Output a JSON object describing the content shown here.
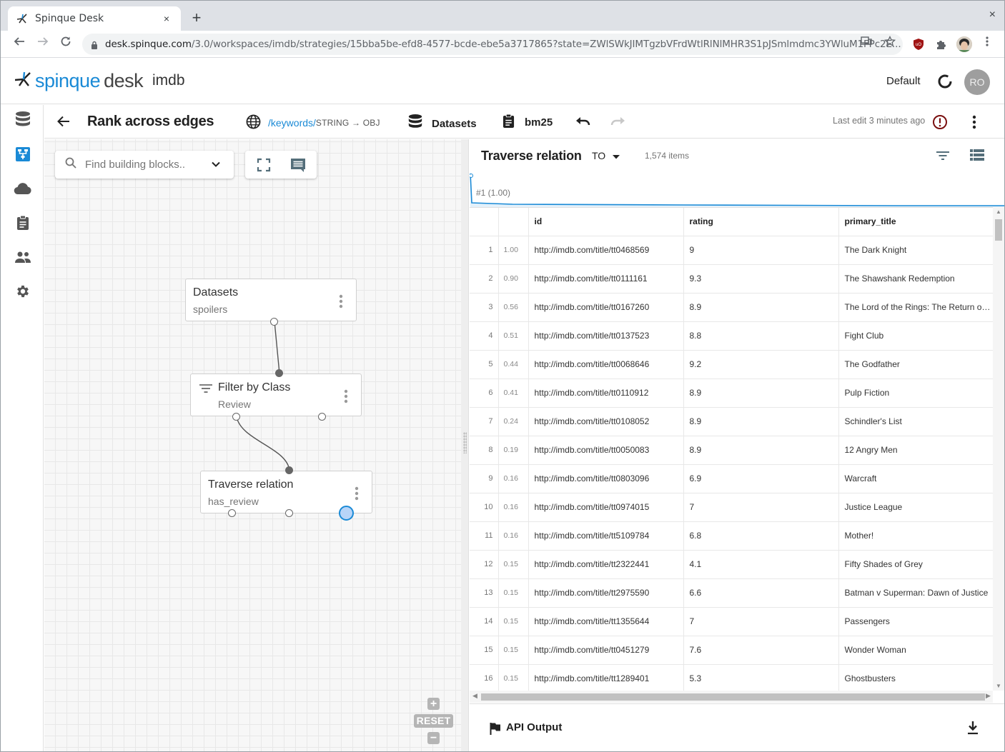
{
  "browser": {
    "tab_title": "Spinque Desk",
    "tab_close": "×",
    "new_tab": "+",
    "window_close": "×",
    "url_host": "desk.spinque.com",
    "url_path": "/3.0/workspaces/imdb/strategies/15bba5be-efd8-4577-bcde-ebe5a3717865?state=ZWlSWkJIMTgzbVFrdWtlRlNlMHR3S1pJSmlmdmc3YWluM1FPc2E..."
  },
  "app": {
    "brand_primary": "spinque",
    "brand_secondary": "desk",
    "workspace": "imdb",
    "environment": "Default",
    "avatar_initials": "RO",
    "accent_color": "#1a8ad6"
  },
  "sidebar": {
    "items": [
      {
        "name": "datasets",
        "icon": "database-icon",
        "active": false
      },
      {
        "name": "strategies",
        "icon": "strategy-icon",
        "active": true
      },
      {
        "name": "apis",
        "icon": "cloud-icon",
        "active": false
      },
      {
        "name": "descriptions",
        "icon": "clipboard-icon",
        "active": false
      },
      {
        "name": "members",
        "icon": "people-icon",
        "active": false
      },
      {
        "name": "settings",
        "icon": "gear-icon",
        "active": false
      }
    ]
  },
  "strategy_bar": {
    "title": "Rank across edges",
    "endpoint_prefix": "/",
    "endpoint_name": "keywords",
    "endpoint_sep": "/",
    "endpoint_types": "STRING → OBJ",
    "dataset_label": "Datasets",
    "description_label": "bm25",
    "last_edit": "Last edit 3 minutes ago"
  },
  "canvas": {
    "search_placeholder": "Find building blocks..",
    "zoom_in": "+",
    "zoom_reset": "RESET",
    "zoom_out": "−",
    "nodes": [
      {
        "title": "Datasets",
        "subtitle": "spoilers"
      },
      {
        "title": "Filter by Class",
        "subtitle": "Review"
      },
      {
        "title": "Traverse relation",
        "subtitle": "has_review"
      }
    ]
  },
  "results": {
    "title": "Traverse relation",
    "output_selector": "TO",
    "count": "1,574 items",
    "score_marker": "#1 (1.00)",
    "columns": [
      "",
      "",
      "id",
      "rating",
      "primary_title"
    ],
    "rows": [
      {
        "n": "1",
        "score": "1.00",
        "id": "http://imdb.com/title/tt0468569",
        "rating": "9",
        "title": "The Dark Knight"
      },
      {
        "n": "2",
        "score": "0.90",
        "id": "http://imdb.com/title/tt0111161",
        "rating": "9.3",
        "title": "The Shawshank Redemption"
      },
      {
        "n": "3",
        "score": "0.56",
        "id": "http://imdb.com/title/tt0167260",
        "rating": "8.9",
        "title": "The Lord of the Rings: The Return of the King"
      },
      {
        "n": "4",
        "score": "0.51",
        "id": "http://imdb.com/title/tt0137523",
        "rating": "8.8",
        "title": "Fight Club"
      },
      {
        "n": "5",
        "score": "0.44",
        "id": "http://imdb.com/title/tt0068646",
        "rating": "9.2",
        "title": "The Godfather"
      },
      {
        "n": "6",
        "score": "0.41",
        "id": "http://imdb.com/title/tt0110912",
        "rating": "8.9",
        "title": "Pulp Fiction"
      },
      {
        "n": "7",
        "score": "0.24",
        "id": "http://imdb.com/title/tt0108052",
        "rating": "8.9",
        "title": "Schindler's List"
      },
      {
        "n": "8",
        "score": "0.19",
        "id": "http://imdb.com/title/tt0050083",
        "rating": "8.9",
        "title": "12 Angry Men"
      },
      {
        "n": "9",
        "score": "0.16",
        "id": "http://imdb.com/title/tt0803096",
        "rating": "6.9",
        "title": "Warcraft"
      },
      {
        "n": "10",
        "score": "0.16",
        "id": "http://imdb.com/title/tt0974015",
        "rating": "7",
        "title": "Justice League"
      },
      {
        "n": "11",
        "score": "0.16",
        "id": "http://imdb.com/title/tt5109784",
        "rating": "6.8",
        "title": "Mother!"
      },
      {
        "n": "12",
        "score": "0.15",
        "id": "http://imdb.com/title/tt2322441",
        "rating": "4.1",
        "title": "Fifty Shades of Grey"
      },
      {
        "n": "13",
        "score": "0.15",
        "id": "http://imdb.com/title/tt2975590",
        "rating": "6.6",
        "title": "Batman v Superman: Dawn of Justice"
      },
      {
        "n": "14",
        "score": "0.15",
        "id": "http://imdb.com/title/tt1355644",
        "rating": "7",
        "title": "Passengers"
      },
      {
        "n": "15",
        "score": "0.15",
        "id": "http://imdb.com/title/tt0451279",
        "rating": "7.6",
        "title": "Wonder Woman"
      },
      {
        "n": "16",
        "score": "0.15",
        "id": "http://imdb.com/title/tt1289401",
        "rating": "5.3",
        "title": "Ghostbusters"
      }
    ],
    "api_output_label": "API Output"
  }
}
